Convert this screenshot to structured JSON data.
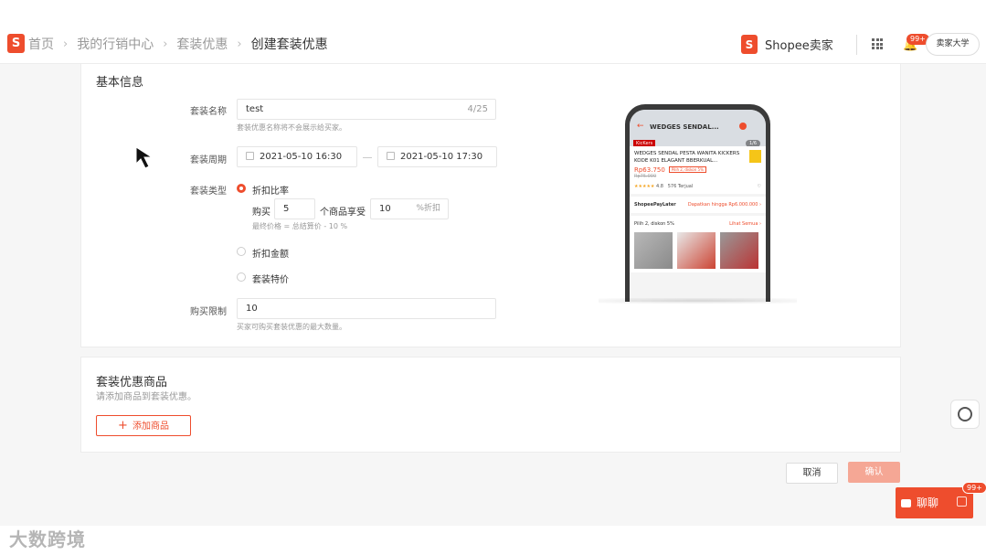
{
  "header": {
    "logo_letter": "S",
    "breadcrumb": [
      "首页",
      "我的行销中心",
      "套装优惠",
      "创建套装优惠"
    ],
    "brand_logo_letter": "S",
    "brand_name": "Shopee卖家",
    "notification_badge": "99+",
    "university_button": "卖家大学"
  },
  "basic_info": {
    "title": "基本信息",
    "name_label": "套装名称",
    "name_value": "test",
    "name_counter": "4/25",
    "name_hint": "套装优惠名称将不会展示给买家。",
    "period_label": "套装周期",
    "period_start": "2021-05-10 16:30",
    "period_end": "2021-05-10 17:30",
    "type_label": "套装类型",
    "type_options": [
      "折扣比率",
      "折扣金额",
      "套装特价"
    ],
    "selected_type": "折扣比率",
    "buy_prefix": "购买",
    "buy_qty": "5",
    "buy_middle": "个商品享受",
    "discount_value": "10",
    "discount_unit": "%折扣",
    "final_price_hint": "最终价格 = 总结算价 - 10 %",
    "limit_label": "购买限制",
    "limit_value": "10",
    "limit_hint": "买家可购买套装优惠的最大数量。"
  },
  "preview": {
    "title": "WEDGES SENDAL...",
    "brand_tag": "KicKers",
    "page": "1/6",
    "product_name": "WEDGES SENDAL PESTA WANITA KICKERS KODE K01 ELAGANT BBERKUAL...",
    "price": "Rp63.750",
    "discount_tag": "Pilih 2, diskon 5%",
    "old_price": "Rp75.000",
    "stars": "★★★★★",
    "rating": "4.8",
    "sold": "576 Terjual",
    "paylater": "ShopeePayLater",
    "paylater_offer": "Dapatkan hingga Rp6.000.000 ›",
    "bundle_text": "Pilih 2, diskon 5%",
    "bundle_link": "Lihat Semua ›"
  },
  "products": {
    "title": "套装优惠商品",
    "hint": "请添加商品到套装优惠。",
    "add_button": "添加商品"
  },
  "footer": {
    "cancel": "取消",
    "confirm": "确认"
  },
  "chat": {
    "label": "聊聊",
    "badge": "99+"
  },
  "watermark": "大数跨境",
  "colors": {
    "accent": "#ee4d2d",
    "confirm_disabled": "#f5a795"
  }
}
